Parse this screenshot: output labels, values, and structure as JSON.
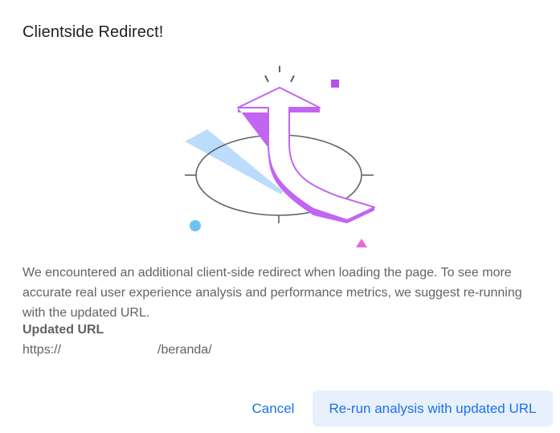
{
  "dialog": {
    "title": "Clientside Redirect!",
    "message": "We encountered an additional client-side redirect when loading the page. To see more accurate real user experience analysis and performance metrics, we suggest re-running with the updated URL.",
    "url_label": "Updated URL",
    "url_prefix": "https://",
    "url_suffix": "/beranda/",
    "cancel_label": "Cancel",
    "rerun_label": "Re-run analysis with updated URL"
  },
  "colors": {
    "arrow": "#c265f2",
    "ellipse": "#5f6368",
    "ribbon": "#bcdcfb",
    "dot": "#6ec2f5",
    "triangle": "#e86bd5",
    "square": "#b84fe6",
    "button_text": "#1a73e8",
    "button_bg": "#e8f0fe"
  },
  "icons": [
    "redirect-arrow-illustration"
  ]
}
